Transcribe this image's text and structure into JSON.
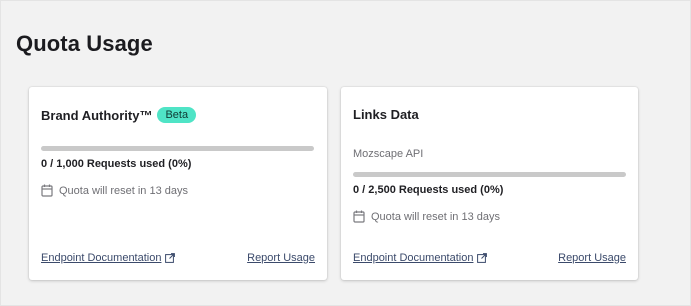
{
  "page": {
    "title": "Quota Usage"
  },
  "cards": [
    {
      "title": "Brand Authority™",
      "badge": "Beta",
      "subtitle": "",
      "usage_text": "0 / 1,000 Requests used (0%)",
      "usage_fraction": 0,
      "reset_text": "Quota will reset in 13 days",
      "doc_link": "Endpoint Documentation",
      "report_link": "Report Usage"
    },
    {
      "title": "Links Data",
      "badge": "",
      "subtitle": "Mozscape API",
      "usage_text": "0 / 2,500 Requests used (0%)",
      "usage_fraction": 0,
      "reset_text": "Quota will reset in 13 days",
      "doc_link": "Endpoint Documentation",
      "report_link": "Report Usage"
    }
  ],
  "colors": {
    "badge": "#4fe4c6",
    "bar_track": "#c9c9c9",
    "link": "#3b4a6b"
  },
  "icons": [
    "calendar-icon",
    "external-link-icon"
  ]
}
